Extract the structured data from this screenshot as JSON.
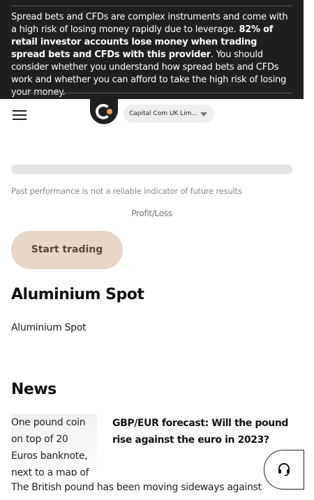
{
  "risk_warning": {
    "part1": "Spread bets and CFDs are complex instruments and come with a high risk of losing money rapidly due to leverage. ",
    "bold": "82% of retail investor accounts lose money when trading spread bets and CFDs with this provider",
    "part2": ". You should consider whether you understand how spread bets and CFDs work and whether you can afford to take the high risk of losing your money."
  },
  "header": {
    "entity_selector": "Capital Com UK Lim..."
  },
  "chart": {
    "disclaimer": "Past performance is not a reliable indicator of future results",
    "profit_loss_label": "Profit/Loss"
  },
  "cta": {
    "start_trading": "Start trading"
  },
  "asset": {
    "title": "Aluminium Spot",
    "subtitle": "Aluminium Spot"
  },
  "news": {
    "section_title": "News",
    "articles": [
      {
        "image_alt": "One pound coin on top of 20 Euros banknote, next to a map of",
        "headline": "GBP/EUR forecast: Will the pound rise against the euro in 2023?",
        "excerpt": "The British pound has been moving sideways against"
      }
    ]
  },
  "icons": {
    "menu": "menu-icon",
    "logo": "capital-com-logo",
    "support": "headset-icon",
    "caret": "caret-down-icon"
  },
  "colors": {
    "banner_bg": "#1f1f1f",
    "cta_bg": "#e8d6c8",
    "cta_text": "#5a4638",
    "logo_accent": "#e2a35d"
  }
}
